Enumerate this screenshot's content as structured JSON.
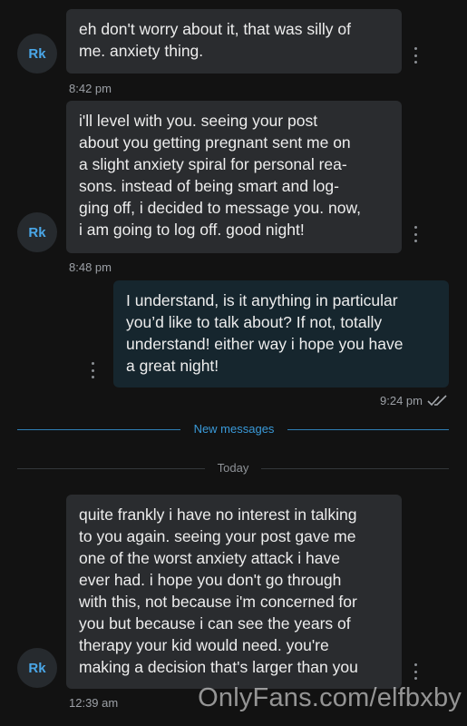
{
  "messages": [
    {
      "sender_initials": "Rk",
      "text": "eh don't worry about it, that was silly of\nme. anxiety thing.",
      "time": "8:42 pm"
    },
    {
      "sender_initials": "Rk",
      "text": "i'll level with you. seeing your post\nabout you getting pregnant sent me on\na slight anxiety spiral for personal rea-\nsons. instead of being smart and log-\nging off, i decided to message you. now,\ni am going to log off. good night!",
      "time": "8:48 pm"
    },
    {
      "text": "I understand, is it anything in particular\nyou’d like to talk about? If not, totally\nunderstand! either way i hope you have\na great night!",
      "time": "9:24 pm",
      "status": "read-double-check-icon"
    },
    {
      "sender_initials": "Rk",
      "text": "quite frankly i have no interest in talking\nto you again. seeing your post gave me\none of the worst anxiety attack i have\never had. i hope you don't go through\nwith this, not because i'm concerned for\nyou but because i can see the years of\ntherapy your kid would need. you're\nmaking a decision that's larger than you",
      "time": "12:39 am"
    }
  ],
  "dividers": {
    "new_messages": "New messages",
    "today": "Today"
  },
  "watermark": "OnlyFans.com/elfbxby",
  "colors": {
    "background": "#121212",
    "incoming_bubble": "#2a2c2f",
    "outgoing_bubble": "#16262e",
    "accent": "#3a9ad9"
  }
}
